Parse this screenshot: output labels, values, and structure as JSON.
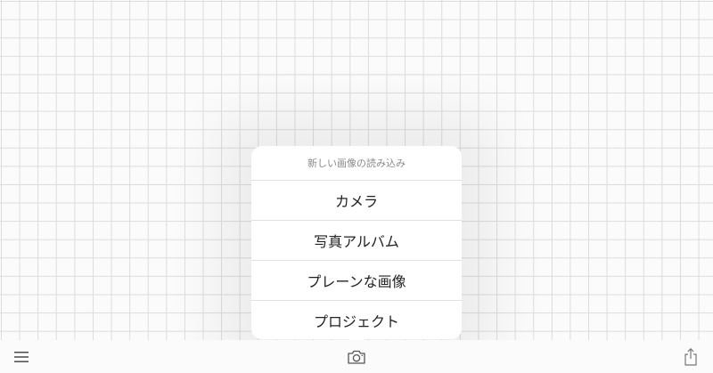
{
  "toolbar": {
    "menu_icon": "hamburger-menu-icon",
    "camera_icon": "camera-icon",
    "share_icon": "share-icon"
  },
  "popover": {
    "title": "新しい画像の読み込み",
    "items": [
      {
        "label": "カメラ"
      },
      {
        "label": "写真アルバム"
      },
      {
        "label": "プレーンな画像"
      },
      {
        "label": "プロジェクト"
      }
    ]
  }
}
